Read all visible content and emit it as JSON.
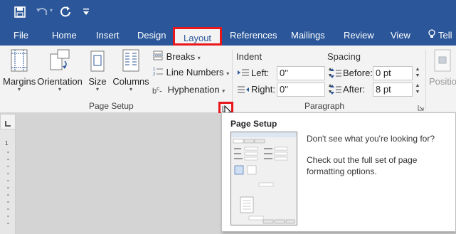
{
  "colors": {
    "brand": "#2b579a",
    "highlight": "#e8171c",
    "ribbon": "#f3f3f3"
  },
  "qat": {
    "save_icon": "save-icon",
    "undo_icon": "undo-icon",
    "redo_icon": "repeat-icon",
    "customize_icon": "customize-qat-icon"
  },
  "tabs": {
    "file": "File",
    "home": "Home",
    "insert": "Insert",
    "design": "Design",
    "layout": "Layout",
    "references": "References",
    "mailings": "Mailings",
    "review": "Review",
    "view": "View",
    "tell": "Tell"
  },
  "page_setup": {
    "margins": "Margins",
    "orientation": "Orientation",
    "size": "Size",
    "columns": "Columns",
    "breaks": "Breaks",
    "line_numbers": "Line Numbers",
    "hyphenation": "Hyphenation",
    "group_label": "Page Setup"
  },
  "paragraph": {
    "indent_heading": "Indent",
    "left_label": "Left:",
    "left_value": "0\"",
    "right_label": "Right:",
    "right_value": "0\"",
    "spacing_heading": "Spacing",
    "before_label": "Before:",
    "before_value": "0 pt",
    "after_label": "After:",
    "after_value": "8 pt",
    "group_label": "Paragraph"
  },
  "arrange": {
    "position": "Positio"
  },
  "tooltip": {
    "title": "Page Setup",
    "line1": "Don't see what you're looking for?",
    "line2": "Check out the full set of page formatting options."
  }
}
